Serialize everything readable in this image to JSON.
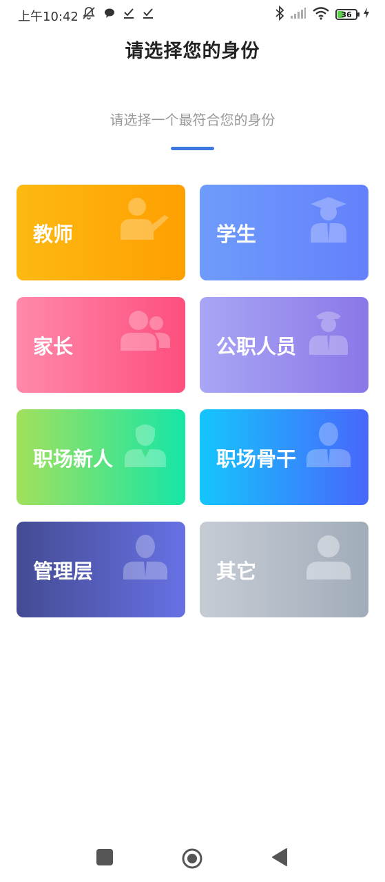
{
  "status_bar": {
    "time": "上午10:42",
    "battery_level": "36",
    "battery_fraction": 0.36,
    "left_icons": [
      "bell-off-icon",
      "chat-bubble-icon",
      "check-download-icon",
      "check-download-icon"
    ],
    "right_icons": [
      "bluetooth-icon",
      "signal-icon",
      "wifi-icon",
      "battery-icon",
      "charging-icon"
    ]
  },
  "header": {
    "title": "请选择您的身份"
  },
  "intro": {
    "subtitle": "请选择一个最符合您的身份",
    "accent_color": "#3b78e0"
  },
  "identities": [
    {
      "id": "teacher",
      "label": "教师",
      "icon": "teacher-icon",
      "colors": [
        "#fdb913",
        "#fe9f00"
      ]
    },
    {
      "id": "student",
      "label": "学生",
      "icon": "student-icon",
      "colors": [
        "#6e9cfb",
        "#6480fb"
      ]
    },
    {
      "id": "parent",
      "label": "家长",
      "icon": "parent-icon",
      "colors": [
        "#fe89aa",
        "#fe4f7e"
      ]
    },
    {
      "id": "civil-servant",
      "label": "公职人员",
      "icon": "officer-icon",
      "colors": [
        "#a9a6f4",
        "#8a77e8"
      ]
    },
    {
      "id": "newcomer",
      "label": "职场新人",
      "icon": "young-professional-icon",
      "colors": [
        "#a2e05c",
        "#16e6a6"
      ]
    },
    {
      "id": "backbone",
      "label": "职场骨干",
      "icon": "professional-icon",
      "colors": [
        "#14c6fd",
        "#4866fb"
      ]
    },
    {
      "id": "management",
      "label": "管理层",
      "icon": "manager-icon",
      "colors": [
        "#444b93",
        "#6771e4"
      ]
    },
    {
      "id": "other",
      "label": "其它",
      "icon": "user-icon",
      "colors": [
        "#c6ccd4",
        "#a1acba"
      ]
    }
  ],
  "nav_bar": {
    "buttons": [
      "recent-apps-icon",
      "home-icon",
      "back-icon"
    ]
  }
}
